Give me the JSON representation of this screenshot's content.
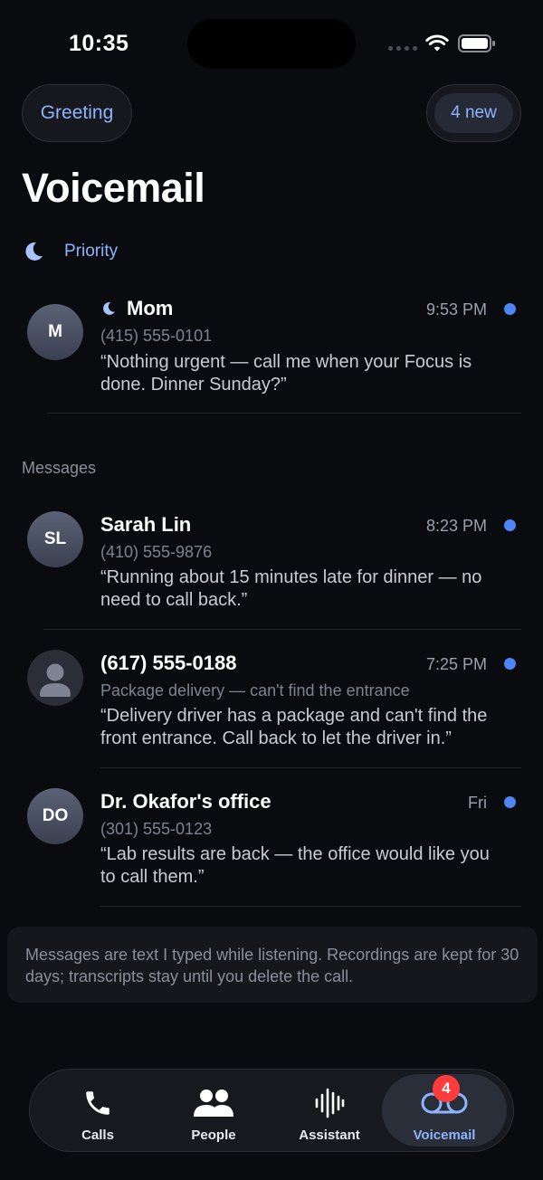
{
  "status_bar": {
    "time": "10:35"
  },
  "header": {
    "greeting_label": "Greeting",
    "new_count_label": "4 new",
    "title": "Voicemail"
  },
  "priority": {
    "label": "Priority"
  },
  "priority_items": [
    {
      "name": "Mom",
      "subline": "(415) 555-0101",
      "time": "9:53 PM",
      "avatar": "M",
      "transcript": "“Nothing urgent — call me when your Focus is done. Dinner Sunday?”",
      "focus_icon": "moon-icon",
      "unread": true
    }
  ],
  "messages": {
    "label": "Messages",
    "items": [
      {
        "name": "Sarah Lin",
        "subline": "(410) 555-9876",
        "time": "8:23 PM",
        "avatar": "SL",
        "transcript": "“Running about 15 minutes late for dinner — no need to call back.”",
        "unread": true
      },
      {
        "name": "(617) 555-0188",
        "subline": "Package delivery — can't find the entrance",
        "time": "7:25 PM",
        "avatar": "",
        "transcript": "“Delivery driver has a package and can't find the front entrance. Call back to let the driver in.”",
        "unread": true
      },
      {
        "name": "Dr. Okafor's office",
        "subline": "(301) 555-0123",
        "time": "Fri",
        "avatar": "DO",
        "transcript": "“Lab results are back — the office would like you to call them.”",
        "unread": true
      }
    ]
  },
  "info": {
    "text": "Messages are text I typed while listening. Recordings are kept for 30 days; transcripts stay until you delete the call."
  },
  "tab_bar": {
    "tabs": [
      {
        "label": "Calls",
        "icon": "phone-icon"
      },
      {
        "label": "People",
        "icon": "people-icon"
      },
      {
        "label": "Assistant",
        "icon": "waveform-icon"
      },
      {
        "label": "Voicemail",
        "icon": "voicemail-icon",
        "active": true
      }
    ],
    "voicemail_badge": "4"
  },
  "colors": {
    "accent": "#8fb4ff",
    "unread_dot": "#4f86f7",
    "badge": "#ff3b3b",
    "background": "#0a0b0f"
  }
}
